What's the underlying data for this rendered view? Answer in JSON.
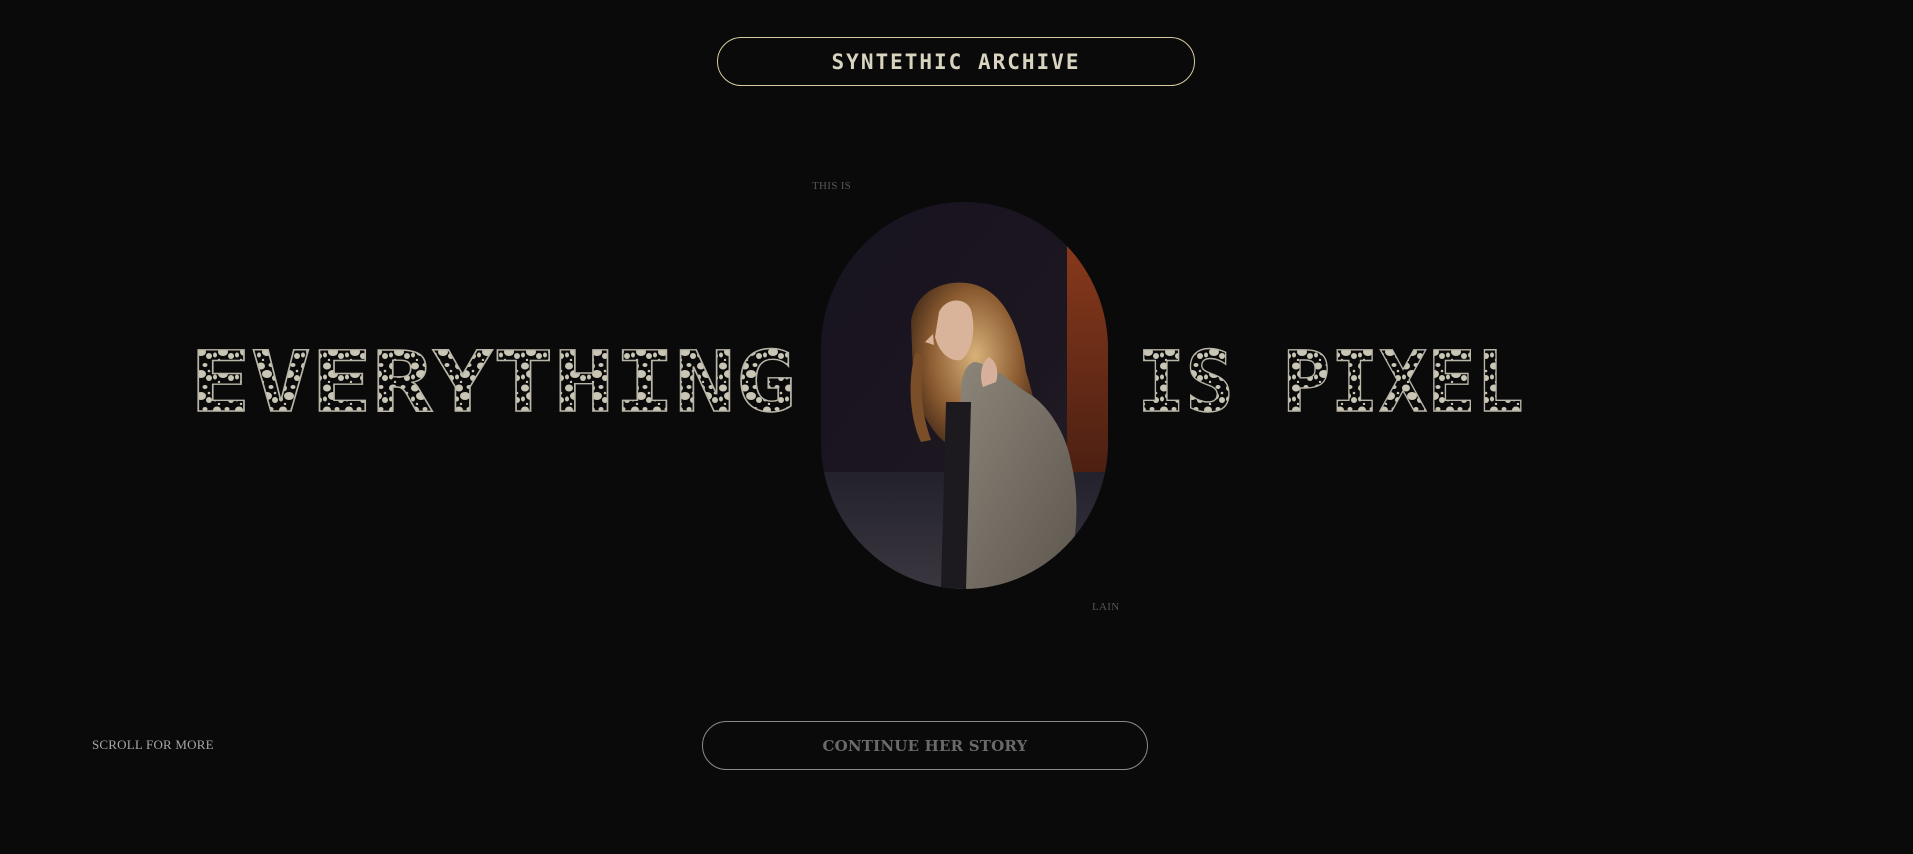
{
  "header": {
    "archive_label": "SYNTETHIC ARCHIVE"
  },
  "hero": {
    "pre_label": "THIS IS",
    "word_left": "EVERYTHING",
    "word_right": "IS PIXEL",
    "post_label": "LAIN",
    "photo_icon": "portrait-photo"
  },
  "footer": {
    "scroll_label": "SCROLL FOR MORE",
    "continue_label": "CONTINUE HER STORY"
  },
  "colors": {
    "background": "#0a0a0a",
    "pill_border": "#d6cba0",
    "speckle_fill": "#c9c6b6"
  }
}
